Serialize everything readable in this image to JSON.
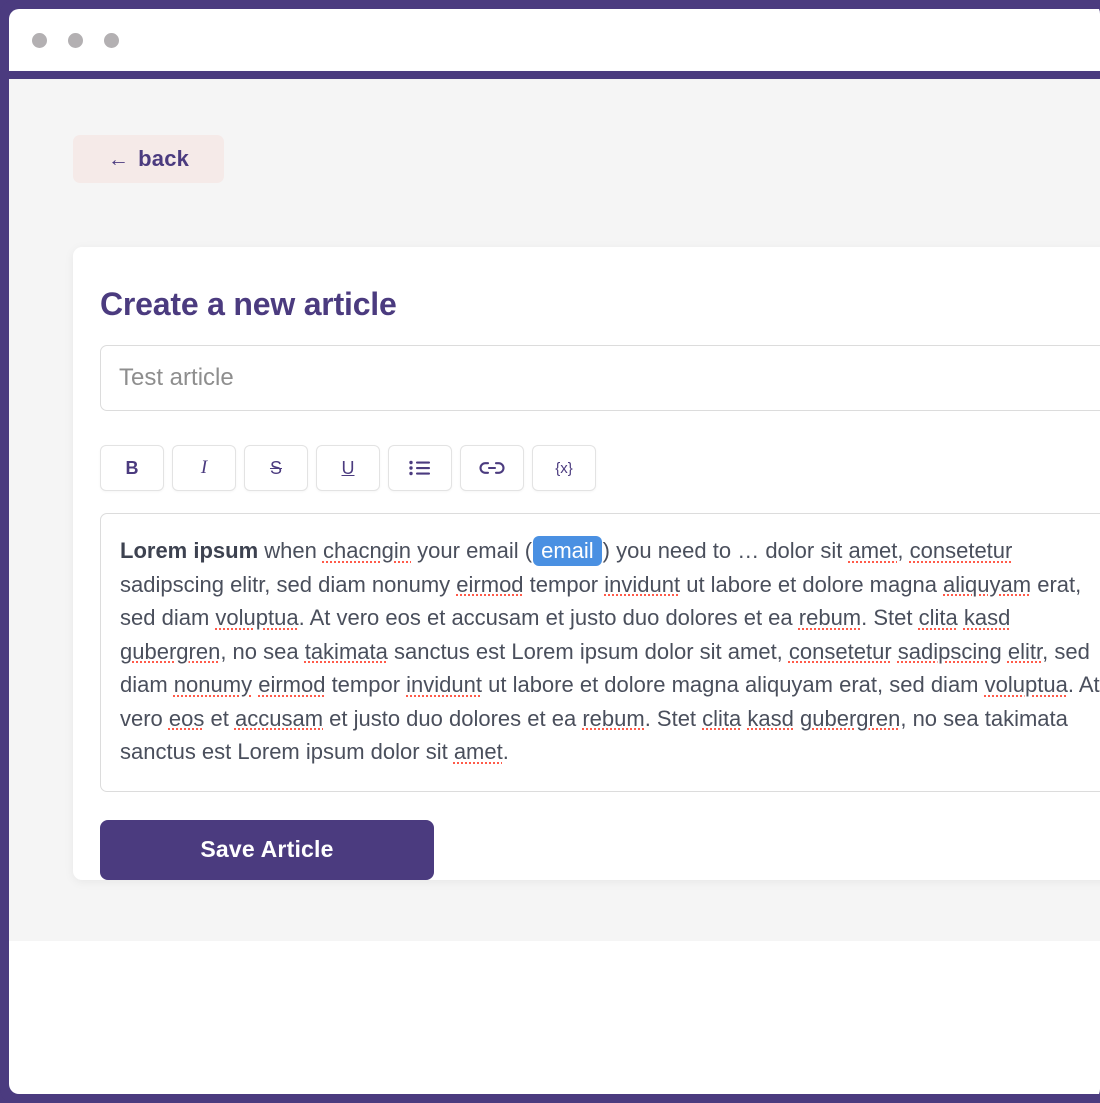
{
  "window": {
    "frame_color": "#4b3b7f",
    "traffic_lights": [
      "window-dot-1",
      "window-dot-2",
      "window-dot-3"
    ]
  },
  "nav": {
    "back_arrow": "←",
    "back_label": "back"
  },
  "form": {
    "title": "Create a new article",
    "title_input": {
      "value": "",
      "placeholder": "Test article"
    },
    "save_label": "Save Article"
  },
  "toolbar": {
    "buttons": [
      {
        "name": "bold-button",
        "label": "B",
        "icon": "bold-icon"
      },
      {
        "name": "italic-button",
        "label": "I",
        "icon": "italic-icon"
      },
      {
        "name": "strikethrough-button",
        "label": "S",
        "icon": "strikethrough-icon"
      },
      {
        "name": "underline-button",
        "label": "U",
        "icon": "underline-icon"
      },
      {
        "name": "bullet-list-button",
        "label": "",
        "icon": "bullet-list-icon"
      },
      {
        "name": "link-button",
        "label": "",
        "icon": "link-icon"
      },
      {
        "name": "variable-button",
        "label": "{x}",
        "icon": "variable-icon"
      }
    ]
  },
  "editor": {
    "bold_lead": "Lorem ipsum",
    "seg_1": " when ",
    "misspelled_1": "chacngin",
    "seg_2": " your email (",
    "chip": "email",
    "seg_3": ") you need to … dolor sit ",
    "misspelled_2": "amet",
    "seg_4": ", ",
    "misspelled_3": "consetetur",
    "seg_5": " sadipscing elitr, sed diam nonumy ",
    "misspelled_4": "eirmod",
    "seg_6": " tempor ",
    "misspelled_5": "invidunt",
    "seg_7": " ut labore et dolore magna ",
    "misspelled_6": "aliquyam",
    "seg_8": " erat, sed diam ",
    "misspelled_7": "voluptua",
    "seg_9": ". At vero eos et accusam et justo duo dolores et ea ",
    "misspelled_8": "rebum",
    "seg_10": ". Stet ",
    "misspelled_9": "clita",
    "seg_11": " ",
    "misspelled_10": "kasd",
    "seg_12": " ",
    "misspelled_11": "gubergren",
    "seg_13": ", no sea ",
    "misspelled_12": "takimata",
    "seg_14": " sanctus est Lorem ipsum dolor sit amet, ",
    "misspelled_13": "consetetur",
    "seg_15": " ",
    "misspelled_14": "sadipscing",
    "seg_16": " ",
    "misspelled_15": "elitr",
    "seg_17": ", sed diam ",
    "misspelled_16": "nonumy",
    "seg_18": " ",
    "misspelled_17": "eirmod",
    "seg_19": " tempor ",
    "misspelled_18": "invidunt",
    "seg_20": " ut labore et dolore magna aliquyam erat, sed diam ",
    "misspelled_19": "voluptua",
    "seg_21": ". At vero ",
    "misspelled_20": "eos",
    "seg_22": " et ",
    "misspelled_21": "accusam",
    "seg_23": " et justo duo dolores et ea ",
    "misspelled_22": "rebum",
    "seg_24": ". Stet ",
    "misspelled_23": "clita",
    "seg_25": " ",
    "misspelled_24": "kasd",
    "seg_26": " ",
    "misspelled_25": "gubergren",
    "seg_27": ", no sea takimata sanctus est Lorem ipsum dolor sit ",
    "misspelled_26": "amet",
    "seg_28": "."
  },
  "colors": {
    "brand_purple": "#4b3b7f",
    "back_button_bg": "#f5eae8",
    "chip_blue": "#4a90e2",
    "spellcheck_red": "#ff5b4a",
    "page_bg": "#f5f5f5",
    "card_bg": "#ffffff",
    "text_gray": "#4a4f5c"
  }
}
